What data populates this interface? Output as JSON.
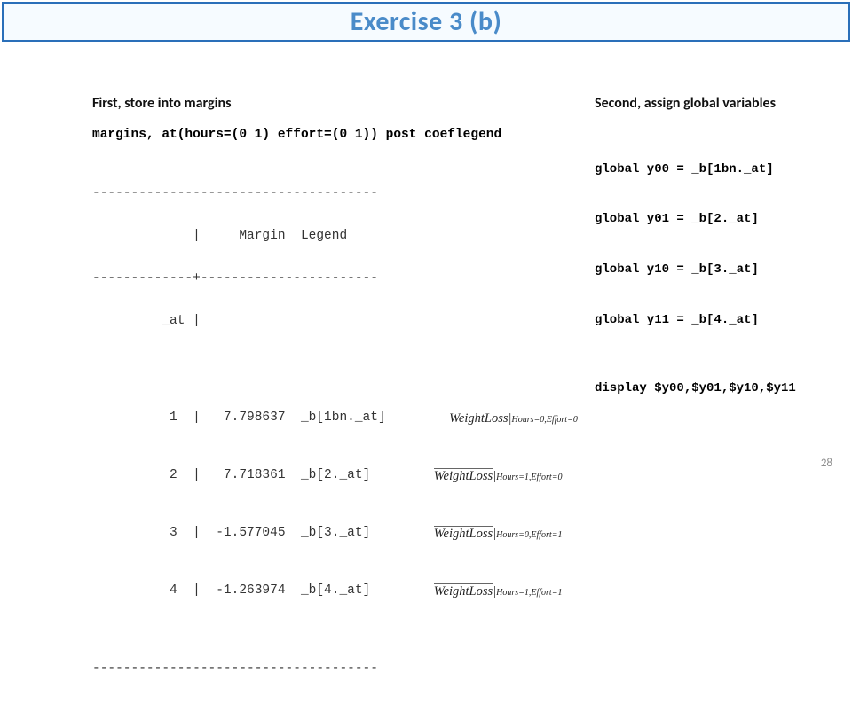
{
  "title": "Exercise 3 (b)",
  "left": {
    "heading": "First, store into margins",
    "command": "margins, at(hours=(0 1) effort=(0 1)) post coeflegend",
    "table": {
      "rule_top": "-------------------------------------",
      "header": "             |     Margin  Legend",
      "rule_mid": "-------------+-----------------------",
      "at_label": "         _at |",
      "rule_bot": "-------------------------------------",
      "rows": [
        {
          "mono": "          1  |   7.798637  _b[1bn._at]",
          "formula_lhs": "WeightLoss",
          "formula_sub": "Hours=0,Effort=0"
        },
        {
          "mono": "          2  |   7.718361  _b[2._at]",
          "formula_lhs": "WeightLoss",
          "formula_sub": "Hours=1,Effort=0"
        },
        {
          "mono": "          3  |  -1.577045  _b[3._at]",
          "formula_lhs": "WeightLoss",
          "formula_sub": "Hours=0,Effort=1"
        },
        {
          "mono": "          4  |  -1.263974  _b[4._at]",
          "formula_lhs": "WeightLoss",
          "formula_sub": "Hours=1,Effort=1"
        }
      ]
    }
  },
  "right": {
    "heading": "Second, assign global variables",
    "globals": [
      "global y00 = _b[1bn._at]",
      "global y01 = _b[2._at]",
      "global y10 = _b[3._at]",
      "global y11 = _b[4._at]"
    ],
    "display": "display $y00,$y01,$y10,$y11"
  },
  "page_number": "28",
  "chart_data": {
    "type": "table",
    "title": "margins output",
    "columns": [
      "_at",
      "Margin",
      "Legend"
    ],
    "rows": [
      [
        1,
        7.798637,
        "_b[1bn._at]"
      ],
      [
        2,
        7.718361,
        "_b[2._at]"
      ],
      [
        3,
        -1.577045,
        "_b[3._at]"
      ],
      [
        4,
        -1.263974,
        "_b[4._at]"
      ]
    ]
  }
}
